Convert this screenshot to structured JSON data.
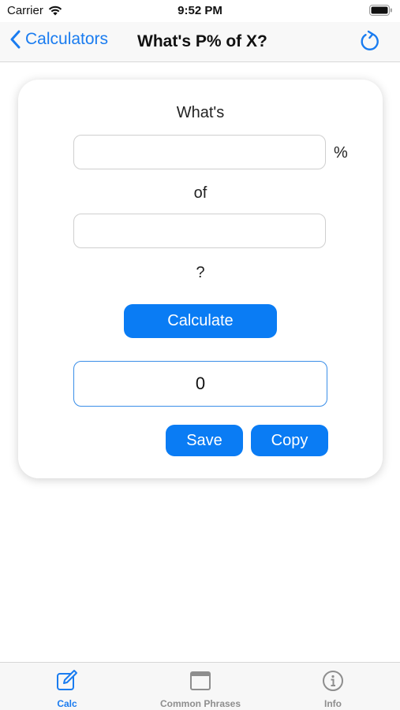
{
  "status_bar": {
    "carrier": "Carrier",
    "time": "9:52 PM"
  },
  "nav": {
    "back_label": "Calculators",
    "title": "What's P% of X?",
    "accent_color": "#1a7cf0"
  },
  "form": {
    "label_whats": "What's",
    "percent_symbol": "%",
    "percent_input_value": "",
    "label_of": "of",
    "x_input_value": "",
    "label_question": "?",
    "calculate_label": "Calculate",
    "result_value": "0",
    "save_label": "Save",
    "copy_label": "Copy"
  },
  "tabs": [
    {
      "label": "Calc",
      "icon": "edit-icon",
      "active": true
    },
    {
      "label": "Common Phrases",
      "icon": "window-icon",
      "active": false
    },
    {
      "label": "Info",
      "icon": "info-icon",
      "active": false
    }
  ]
}
